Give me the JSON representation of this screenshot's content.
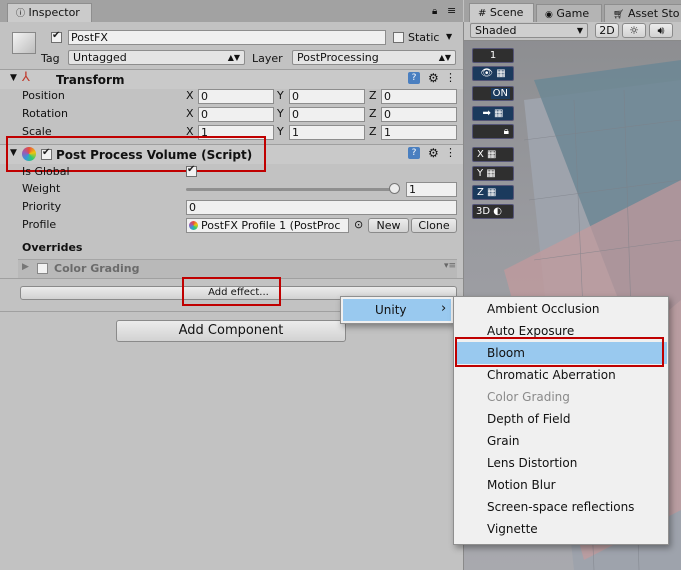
{
  "inspector_tab": {
    "label": "Inspector"
  },
  "scene_tabs": [
    {
      "label": "Scene"
    },
    {
      "label": "Game"
    },
    {
      "label": "Asset Sto"
    }
  ],
  "scene_toolbar": {
    "shading": "Shaded",
    "mode_2d": "2D"
  },
  "gameobject": {
    "name": "PostFX",
    "static_label": "Static",
    "tag_label": "Tag",
    "tag_value": "Untagged",
    "layer_label": "Layer",
    "layer_value": "PostProcessing"
  },
  "transform": {
    "title": "Transform",
    "rows": [
      {
        "label": "Position",
        "x": "0",
        "y": "0",
        "z": "0"
      },
      {
        "label": "Rotation",
        "x": "0",
        "y": "0",
        "z": "0"
      },
      {
        "label": "Scale",
        "x": "1",
        "y": "1",
        "z": "1"
      }
    ],
    "axes": {
      "x": "X",
      "y": "Y",
      "z": "Z"
    }
  },
  "volume": {
    "title": "Post Process Volume (Script)",
    "is_global_label": "Is Global",
    "weight_label": "Weight",
    "weight_value": "1",
    "weight_fraction": 1.0,
    "priority_label": "Priority",
    "priority_value": "0",
    "profile_label": "Profile",
    "profile_value": "PostFX Profile 1 (PostProc",
    "new_label": "New",
    "clone_label": "Clone",
    "overrides_label": "Overrides",
    "effect_item": "Color Grading",
    "add_effect_label": "Add effect..."
  },
  "add_component_label": "Add Component",
  "scene_gizmos": {
    "layer_count": "1",
    "on_label": "ON",
    "x_label": "X",
    "y_label": "Y",
    "z_label": "Z",
    "label_3d": "3D"
  },
  "context_menu": {
    "root_item": "Unity",
    "arrow": "›",
    "items": [
      {
        "label": "Ambient Occlusion",
        "state": "normal"
      },
      {
        "label": "Auto Exposure",
        "state": "normal"
      },
      {
        "label": "Bloom",
        "state": "selected"
      },
      {
        "label": "Chromatic Aberration",
        "state": "normal"
      },
      {
        "label": "Color Grading",
        "state": "disabled"
      },
      {
        "label": "Depth of Field",
        "state": "normal"
      },
      {
        "label": "Grain",
        "state": "normal"
      },
      {
        "label": "Lens Distortion",
        "state": "normal"
      },
      {
        "label": "Motion Blur",
        "state": "normal"
      },
      {
        "label": "Screen-space reflections",
        "state": "normal"
      },
      {
        "label": "Vignette",
        "state": "normal"
      }
    ]
  },
  "colors": {
    "highlight_box": "#c00000",
    "menu_selected": "#99c9ef",
    "scene_button": "#1b3a5d"
  }
}
